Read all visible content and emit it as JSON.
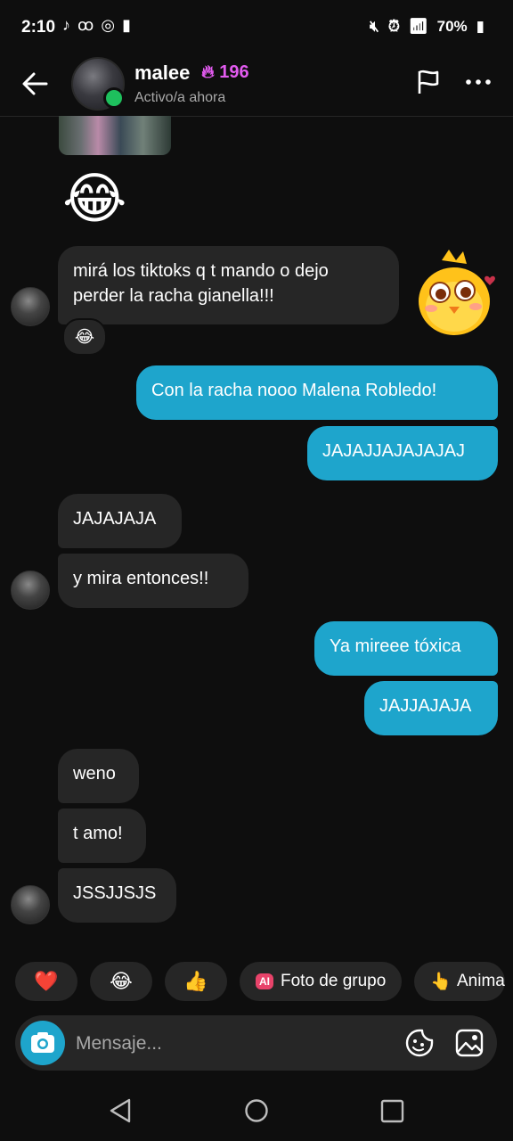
{
  "status_bar": {
    "time": "2:10",
    "battery": "70%"
  },
  "header": {
    "name": "malee",
    "streak_count": "196",
    "presence": "Activo/a ahora"
  },
  "messages": [
    {
      "id": "m1",
      "side": "in",
      "type": "emoji",
      "text": "😂"
    },
    {
      "id": "m2",
      "side": "in",
      "type": "text",
      "text": "mirá los tiktoks q t mando o dejo\nperder la racha gianella!!!",
      "reaction": "😂"
    },
    {
      "id": "m3",
      "side": "out",
      "type": "text",
      "text": "Con la racha nooo Malena Robledo!"
    },
    {
      "id": "m4",
      "side": "out",
      "type": "text",
      "text": "JAJAJJAJAJAJAJ"
    },
    {
      "id": "m5",
      "side": "in",
      "type": "text",
      "text": "JAJAJAJA"
    },
    {
      "id": "m6",
      "side": "in",
      "type": "text",
      "text": "y mira entonces!!"
    },
    {
      "id": "m7",
      "side": "out",
      "type": "text",
      "text": "Ya mireee tóxica"
    },
    {
      "id": "m8",
      "side": "out",
      "type": "text",
      "text": "JAJJAJAJA"
    },
    {
      "id": "m9",
      "side": "in",
      "type": "text",
      "text": "weno"
    },
    {
      "id": "m10",
      "side": "in",
      "type": "text",
      "text": "t amo!"
    },
    {
      "id": "m11",
      "side": "in",
      "type": "text",
      "text": "JSSJJSJS"
    }
  ],
  "quick_replies": {
    "heart": "❤️",
    "laugh": "😂",
    "thumbs": "👍",
    "ai_badge": "AI",
    "group_photo": "Foto de grupo",
    "animate_icon": "👆",
    "animate": "Anima"
  },
  "composer": {
    "placeholder": "Mensaje..."
  },
  "colors": {
    "background": "#0e0e0e",
    "incoming_bubble": "#262626",
    "outgoing_bubble": "#1ea5cc",
    "streak": "#e35bf0",
    "online": "#1ec05d"
  }
}
